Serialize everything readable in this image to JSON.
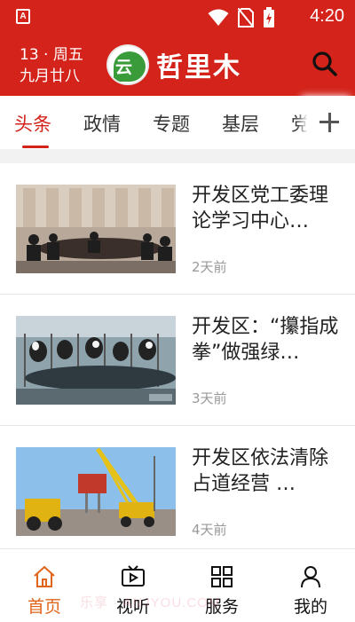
{
  "status_bar": {
    "app_badge": "A",
    "time": "4:20",
    "icons": [
      "wifi-icon",
      "no-sim-icon",
      "battery-icon"
    ]
  },
  "header": {
    "date_line1": "13 · 周五",
    "date_line2": "九月廿八",
    "logo_glyph": "云上",
    "logo_text": "哲里木",
    "brand_color": "#d3231a"
  },
  "tabs": {
    "items": [
      {
        "label": "头条",
        "active": true
      },
      {
        "label": "政情",
        "active": false
      },
      {
        "label": "专题",
        "active": false
      },
      {
        "label": "基层",
        "active": false
      },
      {
        "label": "党",
        "active": false
      }
    ]
  },
  "feed": {
    "items": [
      {
        "title": "开发区党工委理论学习中心…",
        "time": "2天前",
        "image": "meeting-photo"
      },
      {
        "title": "开发区：“攥指成拳”做强绿…",
        "time": "3天前",
        "image": "dairy-farm-photo"
      },
      {
        "title": "开发区依法清除占道经营 …",
        "time": "4天前",
        "image": "road-clearing-photo"
      }
    ]
  },
  "bottom_nav": {
    "items": [
      {
        "label": "首页",
        "icon": "home-icon",
        "active": true
      },
      {
        "label": "视听",
        "icon": "tv-icon",
        "active": false
      },
      {
        "label": "服务",
        "icon": "grid-icon",
        "active": false
      },
      {
        "label": "我的",
        "icon": "user-icon",
        "active": false
      }
    ],
    "active_color": "#e0651a"
  },
  "watermark": "乐享 · ANJYOU.COM"
}
